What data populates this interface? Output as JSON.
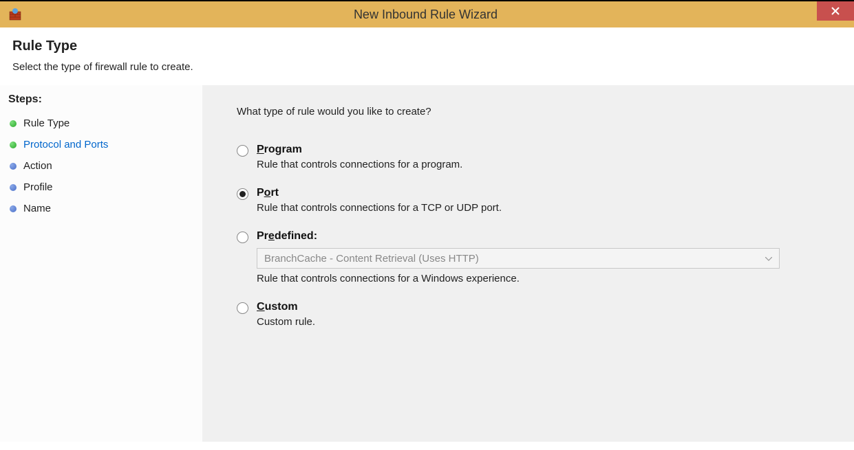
{
  "window": {
    "title": "New Inbound Rule Wizard"
  },
  "header": {
    "title": "Rule Type",
    "subtitle": "Select the type of firewall rule to create."
  },
  "sidebar": {
    "steps_label": "Steps:",
    "items": [
      {
        "label": "Rule Type",
        "bullet": "green",
        "current": false
      },
      {
        "label": "Protocol and Ports",
        "bullet": "green",
        "current": true
      },
      {
        "label": "Action",
        "bullet": "blue",
        "current": false
      },
      {
        "label": "Profile",
        "bullet": "blue",
        "current": false
      },
      {
        "label": "Name",
        "bullet": "blue",
        "current": false
      }
    ]
  },
  "content": {
    "question": "What type of rule would you like to create?",
    "options": {
      "program": {
        "label_pre": "P",
        "label_rest": "rogram",
        "desc": "Rule that controls connections for a program.",
        "selected": false
      },
      "port": {
        "label_pre": "P",
        "label_accel": "o",
        "label_rest": "rt",
        "desc": "Rule that controls connections for a TCP or UDP port.",
        "selected": true
      },
      "predefined": {
        "label_pre": "Pr",
        "label_accel": "e",
        "label_rest": "defined:",
        "desc": "Rule that controls connections for a Windows experience.",
        "select_value": "BranchCache - Content Retrieval (Uses HTTP)",
        "selected": false
      },
      "custom": {
        "label_accel": "C",
        "label_rest": "ustom",
        "desc": "Custom rule.",
        "selected": false
      }
    }
  }
}
